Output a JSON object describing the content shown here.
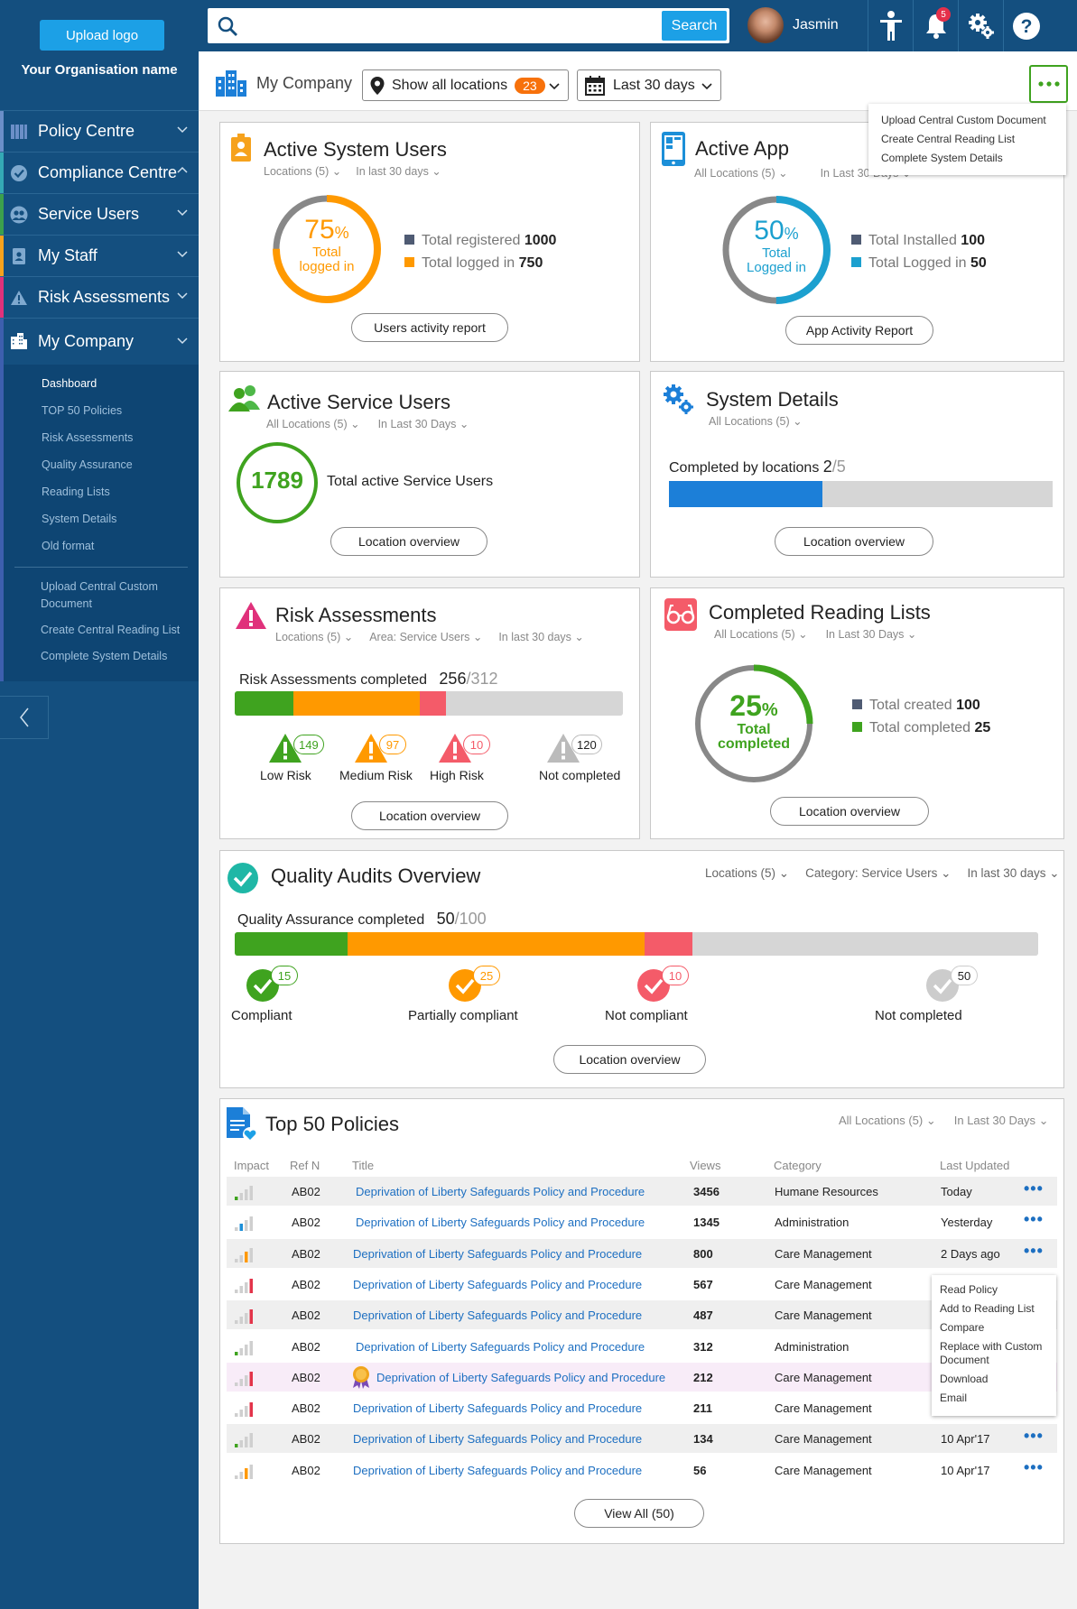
{
  "sidebar": {
    "upload_logo": "Upload logo",
    "org_name": "Your Organisation name",
    "nav": [
      {
        "label": "Policy Centre",
        "color": "#6b8fc8",
        "icon": "books-icon"
      },
      {
        "label": "Compliance Centre",
        "color": "#34a9b5",
        "icon": "check-circle-icon"
      },
      {
        "label": "Service Users",
        "color": "#3ca04c",
        "icon": "users-icon"
      },
      {
        "label": "My Staff",
        "color": "#f6a21d",
        "icon": "id-badge-icon"
      },
      {
        "label": "Risk Assessments",
        "color": "#e0317b",
        "icon": "warning-icon"
      },
      {
        "label": "My Company",
        "color": "#3d5fae",
        "icon": "building-icon"
      }
    ],
    "sub": [
      "Dashboard",
      "TOP 50 Policies",
      "Risk Assessments",
      "Quality Assurance",
      "Reading Lists",
      "System Details",
      "Old format"
    ],
    "sub2": [
      "Upload Central Custom Document",
      "Create Central Reading List",
      "Complete  System Details"
    ]
  },
  "topbar": {
    "search_placeholder": "",
    "search_button": "Search",
    "user_name": "Jasmin",
    "notif_count": "5"
  },
  "crumb": {
    "title": "My Company",
    "locations_label": "Show all locations",
    "locations_count": "23",
    "period": "Last 30 days"
  },
  "more_menu": [
    "Upload Central Custom Document",
    "Create Central Reading List",
    "Complete System Details"
  ],
  "colors": {
    "green": "#3fa31f",
    "orange": "#ff9900",
    "red": "#f45b69",
    "blue": "#1ca0e6",
    "navy": "#144f7f",
    "grey": "#d6d6d6"
  },
  "active_system_users": {
    "title": "Active System Users",
    "filters": [
      "Locations (5)",
      "In last 30 days"
    ],
    "pct": "75",
    "pct_sign": "%",
    "ring_label": "Total logged in",
    "fill": 0.75,
    "legend": [
      {
        "label": "Total registered",
        "value": "1000"
      },
      {
        "label": "Total logged in",
        "value": "750"
      }
    ],
    "button": "Users activity report"
  },
  "active_app": {
    "title": "Active App",
    "filters": [
      "All Locations (5)",
      "In Last 30 Days"
    ],
    "pct": "50",
    "pct_sign": "%",
    "ring_label": "Total Logged in",
    "fill": 0.5,
    "legend": [
      {
        "label": "Total Installed",
        "value": "100"
      },
      {
        "label": "Total Logged in",
        "value": "50"
      }
    ],
    "button": "App Activity Report"
  },
  "active_service_users": {
    "title": "Active Service Users",
    "filters": [
      "All Locations (5)",
      "In Last 30 Days"
    ],
    "count": "1789",
    "label": "Total active Service Users",
    "button": "Location overview"
  },
  "system_details": {
    "title": "System Details",
    "filters": [
      "All Locations (5)"
    ],
    "completed_label": "Completed by locations",
    "done": "2",
    "total": "/5",
    "fill": 0.4,
    "button": "Location overview"
  },
  "risk_assessments": {
    "title": "Risk Assessments",
    "filters": [
      "Locations (5)",
      "Area: Service Users",
      "In last 30 days"
    ],
    "completed_label": "Risk Assessments completed",
    "done": "256",
    "total": "/312",
    "segments": [
      {
        "value": 45,
        "color": "#3fa31f"
      },
      {
        "value": 97,
        "color": "#ff9900"
      },
      {
        "value": 20,
        "color": "#f45b69"
      },
      {
        "value": 136,
        "color": "#d6d6d6"
      }
    ],
    "stats": [
      {
        "label": "Low Risk",
        "count": "149",
        "color": "#3fa31f"
      },
      {
        "label": "Medium Risk",
        "count": "97",
        "color": "#ff9900"
      },
      {
        "label": "High Risk",
        "count": "10",
        "color": "#f45b69"
      },
      {
        "label": "Not completed",
        "count": "120",
        "color": "#bbbbbb"
      }
    ],
    "button": "Location overview"
  },
  "reading_lists": {
    "title": "Completed Reading Lists",
    "filters": [
      "All Locations (5)",
      "In Last 30 Days"
    ],
    "pct": "25",
    "pct_sign": "%",
    "ring_label": "Total completed",
    "fill": 0.25,
    "legend": [
      {
        "label": "Total created",
        "value": "100"
      },
      {
        "label": "Total completed",
        "value": "25"
      }
    ],
    "button": "Location overview"
  },
  "quality_audits": {
    "title": "Quality Audits Overview",
    "filters": [
      "Locations (5)",
      "Category: Service Users",
      "In last 30 days"
    ],
    "completed_label": "Quality Assurance completed",
    "done": "50",
    "total": "/100",
    "segments": [
      {
        "value": 14,
        "color": "#3fa31f"
      },
      {
        "value": 37,
        "color": "#ff9900"
      },
      {
        "value": 6,
        "color": "#f45b69"
      },
      {
        "value": 43,
        "color": "#d6d6d6"
      }
    ],
    "stats": [
      {
        "label": "Compliant",
        "count": "15",
        "color": "#3fa31f"
      },
      {
        "label": "Partially compliant",
        "count": "25",
        "color": "#ff9900"
      },
      {
        "label": "Not compliant",
        "count": "10",
        "color": "#f45b69"
      },
      {
        "label": "Not  completed",
        "count": "50",
        "color": "#cccccc"
      }
    ],
    "button": "Location overview"
  },
  "policies": {
    "title": "Top 50 Policies",
    "filters": [
      "All Locations (5)",
      "In Last 30 Days"
    ],
    "columns": [
      "Impact",
      "Ref N",
      "Title",
      "Views",
      "Category",
      "Last Updated"
    ],
    "rows": [
      {
        "ref": "AB02",
        "title": "Deprivation of Liberty Safeguards Policy and Procedure",
        "views": "3456",
        "category": "Humane Resources",
        "updated": "Today",
        "impact": 1
      },
      {
        "ref": "AB02",
        "title": "Deprivation of Liberty Safeguards Policy and Procedure",
        "views": "1345",
        "category": "Administration",
        "updated": "Yesterday",
        "impact": 2
      },
      {
        "ref": "AB02",
        "title": "Deprivation of Liberty Safeguards Policy and Procedure",
        "views": "800",
        "category": "Care Management",
        "updated": "2 Days ago",
        "impact": 3
      },
      {
        "ref": "AB02",
        "title": "Deprivation of Liberty Safeguards Policy and Procedure",
        "views": "567",
        "category": "Care Management",
        "updated": "",
        "impact": 4
      },
      {
        "ref": "AB02",
        "title": "Deprivation of Liberty Safeguards Policy and Procedure",
        "views": "487",
        "category": "Care Management",
        "updated": "",
        "impact": 4
      },
      {
        "ref": "AB02",
        "title": "Deprivation of Liberty Safeguards Policy and Procedure",
        "views": "312",
        "category": "Administration",
        "updated": "",
        "impact": 1
      },
      {
        "ref": "AB02",
        "title": "Deprivation of Liberty Safeguards Policy and Procedure",
        "views": "212",
        "category": "Care Management",
        "updated": "",
        "impact": 4
      },
      {
        "ref": "AB02",
        "title": "Deprivation of Liberty Safeguards Policy and Procedure",
        "views": "211",
        "category": "Care Management",
        "updated": "",
        "impact": 4
      },
      {
        "ref": "AB02",
        "title": "Deprivation of Liberty Safeguards Policy and Procedure",
        "views": "134",
        "category": "Care Management",
        "updated": "10 Apr'17",
        "impact": 1
      },
      {
        "ref": "AB02",
        "title": "Deprivation of Liberty Safeguards Policy and Procedure",
        "views": "56",
        "category": "Care Management",
        "updated": "10 Apr'17",
        "impact": 3
      }
    ],
    "row_menu": [
      "Read Policy",
      "Add to Reading List",
      "Compare",
      "Replace with Custom Document",
      "Download",
      "Email"
    ],
    "view_all": "View All (50)"
  }
}
